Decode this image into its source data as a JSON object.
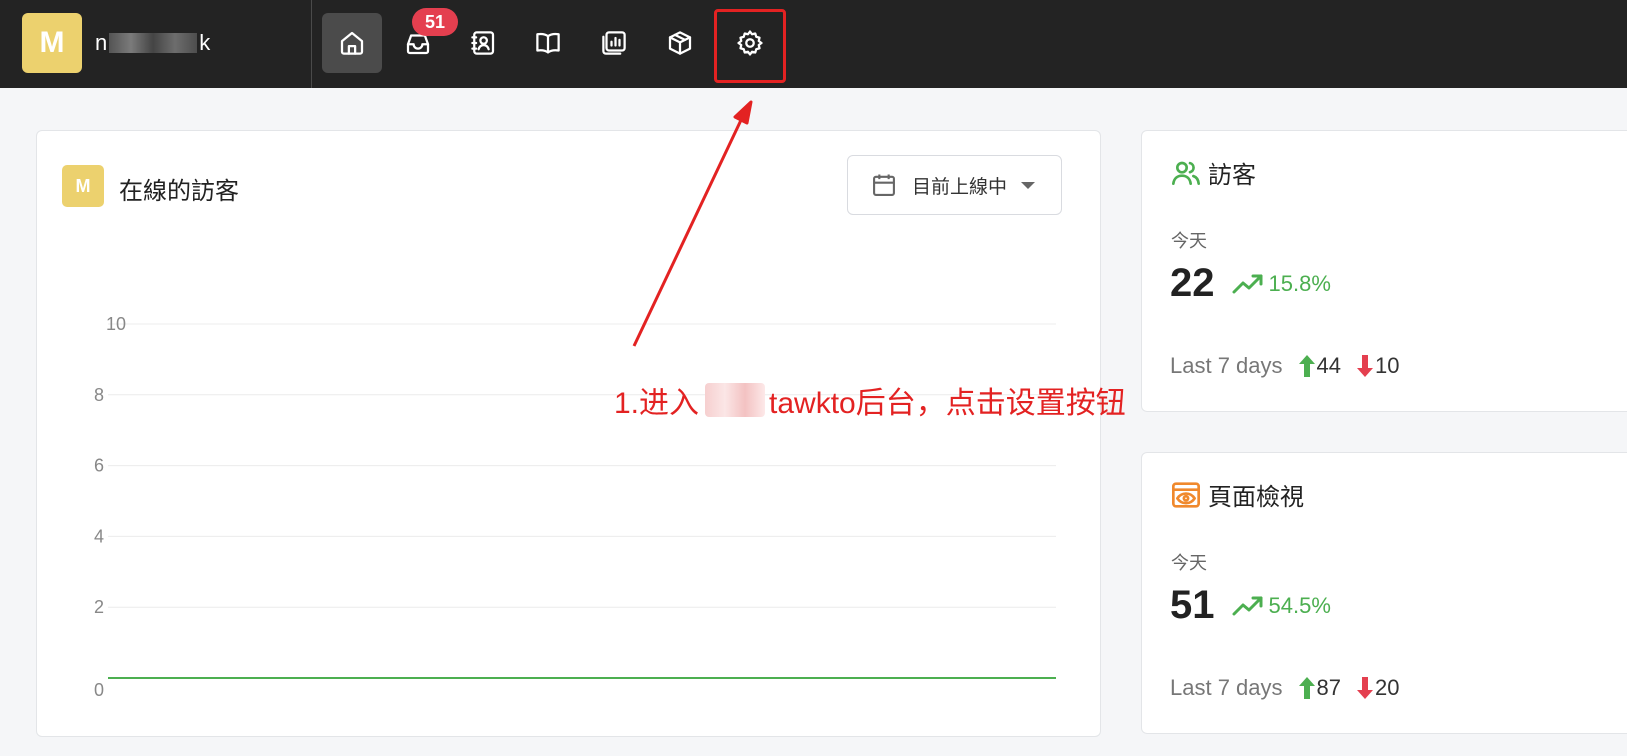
{
  "topbar": {
    "workspace_initial": "M",
    "workspace_name_start": "n",
    "workspace_name_end": "k",
    "nav": [
      {
        "name": "home-icon",
        "active": true
      },
      {
        "name": "inbox-icon",
        "badge": "51"
      },
      {
        "name": "contacts-icon"
      },
      {
        "name": "knowledge-base-icon"
      },
      {
        "name": "reporting-icon"
      },
      {
        "name": "add-ons-icon"
      },
      {
        "name": "settings-icon"
      }
    ],
    "inbox_badge": "51"
  },
  "main_card": {
    "avatar_initial": "M",
    "title": "在線的訪客",
    "filter_label": "目前上線中"
  },
  "chart_data": {
    "type": "line",
    "title": "",
    "xlabel": "",
    "ylabel": "",
    "ylim": [
      0,
      10
    ],
    "yticks": [
      "0",
      "2",
      "4",
      "6",
      "8",
      "10"
    ],
    "series": [
      {
        "values": [
          0,
          0,
          0,
          0,
          0,
          0,
          0
        ]
      }
    ],
    "grid": true,
    "color": "#4caf50"
  },
  "visitors": {
    "title": "訪客",
    "today_label": "今天",
    "value": "22",
    "trend": "15.8%",
    "last7_label": "Last 7 days",
    "up": "44",
    "down": "10"
  },
  "pageviews": {
    "title": "頁面檢視",
    "today_label": "今天",
    "value": "51",
    "trend": "54.5%",
    "last7_label": "Last 7 days",
    "up": "87",
    "down": "20"
  },
  "annotation": {
    "text_prefix": "1.进入",
    "text_suffix": "tawkto后台，点击设置按钮"
  },
  "colors": {
    "topbar": "#232323",
    "accent_yellow": "#ecd16e",
    "green": "#4caf50",
    "red": "#e43f4f",
    "annotation_red": "#e32222",
    "pageview_orange": "#f0892d"
  }
}
